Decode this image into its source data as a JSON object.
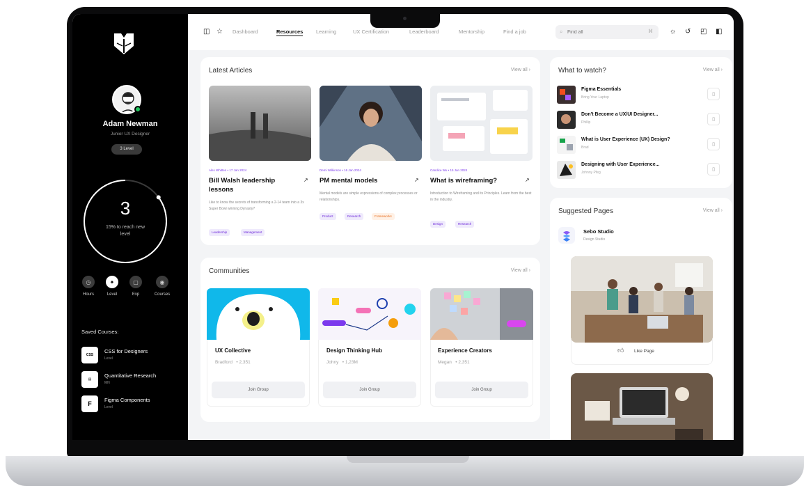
{
  "sidebar": {
    "user": {
      "name": "Adam Newman",
      "role": "Junior UX Designer",
      "level_badge": "3 Level"
    },
    "progress": {
      "level": "3",
      "caption": "15% to reach new level",
      "percent": 15
    },
    "stats": [
      {
        "label": "Hours",
        "icon": "clock-icon"
      },
      {
        "label": "Level",
        "icon": "level-icon"
      },
      {
        "label": "Exp",
        "icon": "exp-icon"
      },
      {
        "label": "Courses",
        "icon": "courses-icon"
      }
    ],
    "saved_title": "Saved Courses:",
    "saved_courses": [
      {
        "title": "CSS for Designers",
        "sub": "Level",
        "icon_text": "CSS"
      },
      {
        "title": "Quantitative Research",
        "sub": "MN",
        "icon_text": "doc"
      },
      {
        "title": "Figma Components",
        "sub": "Level",
        "icon_text": "F"
      }
    ]
  },
  "topbar": {
    "nav": [
      "Dashboard",
      "Resources",
      "Learning",
      "UX Certification",
      "Leaderboard",
      "Mentorship",
      "Find a job"
    ],
    "active_nav": "Resources",
    "search_placeholder": "Find all",
    "search_shortcut": "⌘"
  },
  "articles": {
    "title": "Latest Articles",
    "view_all": "View all",
    "items": [
      {
        "meta": "Alex Whitten • 17 Jan 2024",
        "title": "Bill Walsh leadership lessons",
        "desc": "Like to know the secrets of transforming a 2-14 team into a 3x Super Bowl winning Dynasty?",
        "tags": [
          "Leadership",
          "Management"
        ]
      },
      {
        "meta": "Demi Wilkinson • 16 Jan 2024",
        "title": "PM mental models",
        "desc": "Mental models are simple expressions of complex processes or relationships.",
        "tags": [
          "Product",
          "Research",
          "Frameworks"
        ]
      },
      {
        "meta": "Candice Wu • 15 Jan 2024",
        "title": "What is wireframing?",
        "desc": "Introduction to Wireframing and its Principles. Learn from the best in the industry.",
        "tags": [
          "Design",
          "Research"
        ]
      }
    ]
  },
  "communities": {
    "title": "Communities",
    "view_all": "View all",
    "items": [
      {
        "title": "UX Collective",
        "owner": "Bradford",
        "count": "• 2,351",
        "button": "Join Group"
      },
      {
        "title": "Design Thinking Hub",
        "owner": "Johny",
        "count": "• 1,23M",
        "button": "Join Group"
      },
      {
        "title": "Experience Creators",
        "owner": "Megan",
        "count": "• 2,351",
        "button": "Join Group"
      }
    ]
  },
  "watch": {
    "title": "What to watch?",
    "view_all": "View all",
    "items": [
      {
        "title": "Figma Essentials",
        "sub": "Bring Your Laptop"
      },
      {
        "title": "Don't Become a UX/UI Designer...",
        "sub": "Phillip"
      },
      {
        "title": "What is User Experience (UX) Design?",
        "sub": "Brad"
      },
      {
        "title": "Designing with User Experience...",
        "sub": "Johnny Pfeg"
      }
    ]
  },
  "suggested": {
    "title": "Suggested Pages",
    "view_all": "View all",
    "page_name": "Sebo Studio",
    "page_sub": "Design Studio",
    "like_label": "Like Page"
  },
  "colors": {
    "accent": "#7c3aed",
    "online": "#22c55e",
    "sidebar_bg": "#000000"
  }
}
